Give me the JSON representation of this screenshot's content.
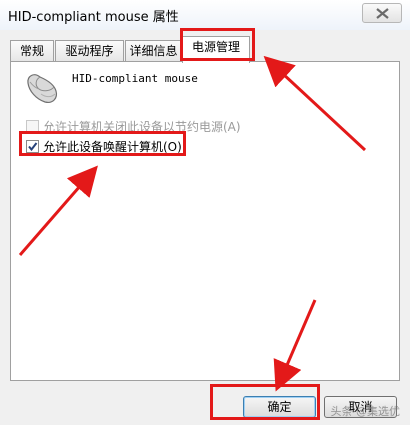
{
  "window": {
    "title": "HID-compliant mouse 属性",
    "close_icon": "close-icon"
  },
  "tabs": [
    {
      "label": "常规",
      "active": false
    },
    {
      "label": "驱动程序",
      "active": false
    },
    {
      "label": "详细信息",
      "active": false
    },
    {
      "label": "电源管理",
      "active": true
    }
  ],
  "device": {
    "icon": "mouse-icon",
    "name": "HID-compliant mouse"
  },
  "options": {
    "allow_power_off": {
      "label": "允许计算机关闭此设备以节约电源(A)",
      "checked": false,
      "enabled": false
    },
    "allow_wake": {
      "label": "允许此设备唤醒计算机(O)",
      "checked": true,
      "enabled": true
    }
  },
  "buttons": {
    "ok": "确定",
    "cancel": "取消"
  },
  "watermark": "头条 @集选优",
  "colors": {
    "highlight": "#e31919",
    "arrow": "#e31919"
  }
}
